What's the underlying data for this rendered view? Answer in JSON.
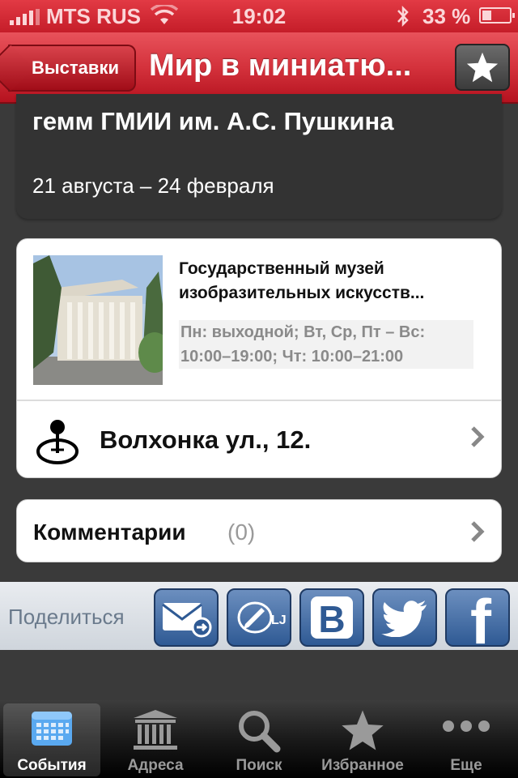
{
  "status_bar": {
    "carrier": "MTS RUS",
    "time": "19:02",
    "battery": "33 %"
  },
  "nav": {
    "back_label": "Выставки",
    "title": "Мир в миниатю..."
  },
  "event": {
    "title": "гемм ГМИИ им. А.С. Пушкина",
    "dates": "21 августа – 24 февраля"
  },
  "museum": {
    "name_line1": "Государственный музей",
    "name_line2": "изобразительных искусств...",
    "hours_line1": "Пн: выходной; Вт, Ср, Пт – Вс:",
    "hours_line2": "10:00–19:00; Чт: 10:00–21:00",
    "address": "Волхонка ул., 12."
  },
  "comments": {
    "label": "Комментарии",
    "count": "(0)"
  },
  "share": {
    "label": "Поделиться",
    "services": [
      {
        "icon": "email-icon"
      },
      {
        "icon": "livejournal-icon",
        "text": "LJ"
      },
      {
        "icon": "vkontakte-icon",
        "text": "B"
      },
      {
        "icon": "twitter-icon"
      },
      {
        "icon": "facebook-icon",
        "text": "f"
      }
    ]
  },
  "tabs": [
    {
      "label": "События",
      "icon": "calendar-icon",
      "active": true
    },
    {
      "label": "Адреса",
      "icon": "building-icon",
      "active": false
    },
    {
      "label": "Поиск",
      "icon": "search-icon",
      "active": false
    },
    {
      "label": "Избранное",
      "icon": "star-icon",
      "active": false
    },
    {
      "label": "Еще",
      "icon": "more-icon",
      "active": false
    }
  ],
  "colors": {
    "accent": "#c51d29",
    "share_button": "#3a6399"
  }
}
